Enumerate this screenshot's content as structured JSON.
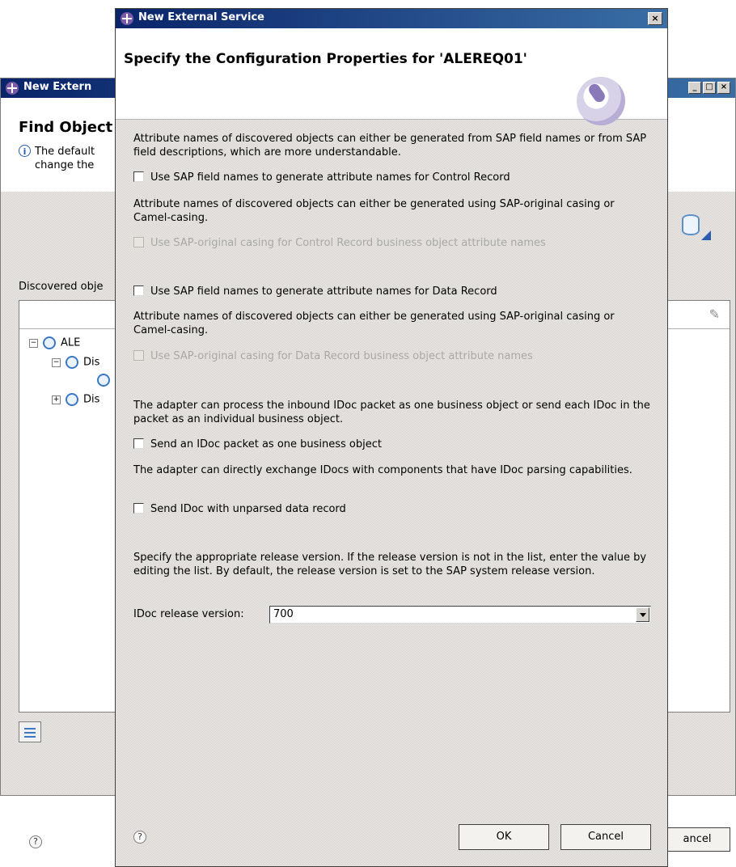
{
  "background_dialog": {
    "title": "New Extern",
    "heading": "Find Object",
    "info_line1": "The default",
    "info_line2": "change the",
    "discovered_label": "Discovered obje",
    "tree": [
      {
        "label": "ALE",
        "expander": "−"
      },
      {
        "label": "Dis",
        "expander": "−"
      },
      {
        "label": "",
        "expander": ""
      },
      {
        "label": "Dis",
        "expander": "+"
      }
    ],
    "cancel_label": "ancel",
    "help_glyph": "?"
  },
  "dialog": {
    "title": "New External Service",
    "close_glyph": "×",
    "heading": "Specify the Configuration Properties for 'ALEREQ01'",
    "sections": {
      "control_desc": "Attribute names of discovered objects can either be generated from SAP field names or from SAP field descriptions, which are more understandable.",
      "control_field_names": "Use SAP field names to generate attribute names for Control Record",
      "control_casing_desc": "Attribute names of discovered objects can either be generated using SAP-original casing or Camel-casing.",
      "control_casing": "Use SAP-original casing for Control Record business object attribute names",
      "data_field_names": "Use SAP field names to generate attribute names for Data Record",
      "data_casing_desc": "Attribute names of discovered objects can either be generated using SAP-original casing or Camel-casing.",
      "data_casing": "Use SAP-original casing for Data Record business object attribute names",
      "packet_desc": "The adapter can process the inbound IDoc packet as one business object or send each IDoc in the packet as an individual business object.",
      "packet_option": "Send an IDoc packet as one business object",
      "unparsed_desc": "The adapter can directly exchange IDocs with components that have IDoc parsing capabilities.",
      "unparsed_option": "Send IDoc with unparsed data record",
      "release_desc": "Specify the appropriate release version. If the release version is not in the list, enter the value by editing the list. By default, the release version is set to the SAP system release version.",
      "release_label": "IDoc release version:",
      "release_value": "700"
    },
    "checkboxes": {
      "control_field_names": false,
      "control_casing": false,
      "data_field_names": false,
      "data_casing": false,
      "packet_option": false,
      "unparsed_option": false
    },
    "buttons": {
      "ok": "OK",
      "cancel": "Cancel",
      "help_glyph": "?"
    }
  },
  "colors": {
    "titlebar_start": "#0a246a",
    "titlebar_end": "#3a6ea5",
    "dialog_face": "#d6d3ce",
    "disabled_text": "#aaa9a5"
  }
}
